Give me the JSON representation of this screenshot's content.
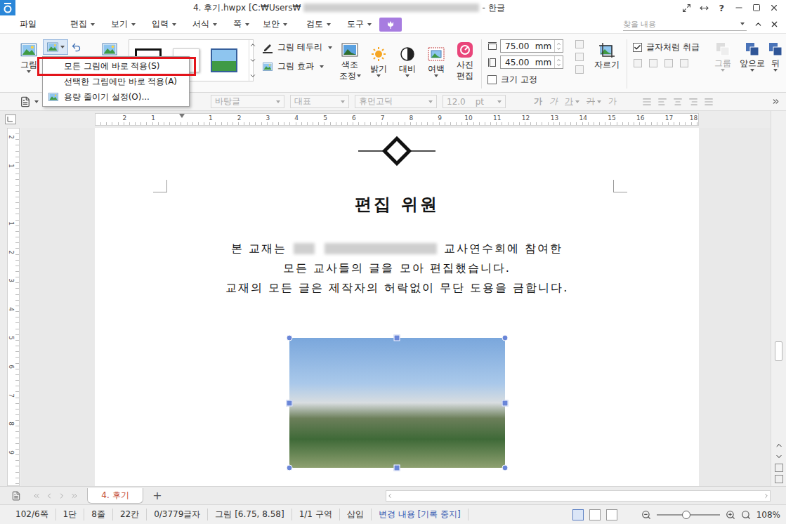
{
  "window": {
    "title_start": "4. 후기.hwpx [C:₩Users₩",
    "title_end": "- 한글",
    "help": "?"
  },
  "menu": [
    {
      "label": "파일",
      "has_caret": false
    },
    {
      "label": "편집",
      "has_caret": true
    },
    {
      "label": "보기",
      "has_caret": true
    },
    {
      "label": "입력",
      "has_caret": true
    },
    {
      "label": "서식",
      "has_caret": true
    },
    {
      "label": "쪽",
      "has_caret": true
    },
    {
      "label": "보안",
      "has_caret": true
    },
    {
      "label": "검토",
      "has_caret": true
    },
    {
      "label": "도구",
      "has_caret": true
    }
  ],
  "search": {
    "placeholder": "찾을 내용"
  },
  "ribbon": {
    "picture": {
      "label": "그림"
    },
    "apply_menu": [
      {
        "label": "모든 그림에 바로 적용(S)",
        "highlighted": true,
        "has_icon": false
      },
      {
        "label": "선택한 그림에만 바로 적용(A)",
        "highlighted": false,
        "has_icon": false
      },
      {
        "label": "용량 줄이기 설정(O)...",
        "highlighted": false,
        "has_icon": true
      }
    ],
    "frame_tools": [
      {
        "label": "그림 테두리",
        "kind": "border"
      },
      {
        "label": "그림 효과",
        "kind": "effect"
      }
    ],
    "adjust": [
      {
        "lines": [
          "색조",
          "조정"
        ],
        "kind": "tone",
        "has_caret": true
      },
      {
        "lines": [
          "밝기"
        ],
        "kind": "brightness",
        "has_caret": true
      },
      {
        "lines": [
          "대비"
        ],
        "kind": "contrast",
        "has_caret": true
      },
      {
        "lines": [
          "여백"
        ],
        "kind": "margin",
        "has_caret": true
      },
      {
        "lines": [
          "사진",
          "편집"
        ],
        "kind": "photo",
        "has_caret": false
      }
    ],
    "size": {
      "width": "75.00",
      "height": "45.00",
      "unit": "mm"
    },
    "size_lock": {
      "label": "크기 고정",
      "checked": false
    },
    "crop": {
      "label": "자르기"
    },
    "treat_as_char": {
      "label": "글자처럼 취급",
      "checked": true
    },
    "arrange": [
      {
        "label": "그룹",
        "disabled": true
      },
      {
        "label": "앞으로",
        "disabled": false
      },
      {
        "label": "뒤",
        "disabled": false
      }
    ]
  },
  "format_bar": {
    "style": "바탕글",
    "language": "대표",
    "font": "휴먼고딕",
    "size": "12.0",
    "unit": "pt",
    "disabled": true,
    "char_buttons": [
      {
        "label": "가",
        "kind": "bold"
      },
      {
        "label": "가",
        "kind": "italic"
      },
      {
        "label": "가",
        "kind": "underline"
      },
      {
        "label": "가",
        "kind": "strike"
      },
      {
        "label": "가",
        "kind": "color"
      }
    ]
  },
  "ruler": {
    "left": [
      "2",
      "1"
    ],
    "right": [
      "1",
      "2",
      "3",
      "4",
      "5",
      "6",
      "7",
      "8",
      "9",
      "10",
      "11",
      "12",
      "13",
      "14",
      "15",
      "16",
      "17",
      "18"
    ],
    "vertical_top": [
      "2",
      "1"
    ],
    "vertical_bottom": [
      "1",
      "2",
      "3",
      "4",
      "5",
      "6",
      "7",
      "8",
      "9"
    ]
  },
  "document": {
    "heading": "편집 위원",
    "lines": [
      [
        {
          "kind": "text",
          "text": "본 교재는"
        },
        {
          "kind": "blur-short"
        },
        {
          "kind": "blur-long"
        },
        {
          "kind": "text",
          "text": "교사연수회에 참여한"
        }
      ],
      [
        {
          "kind": "text",
          "text": "모든 교사들의 글을 모아 편집했습니다."
        }
      ],
      [
        {
          "kind": "text",
          "text": "교재의 모든 글은 제작자의 허락없이 무단 도용을 금합니다."
        }
      ]
    ],
    "image": {
      "selected": true
    }
  },
  "scroll": {
    "level": 0.75
  },
  "tabs": [
    {
      "label": "4. 후기",
      "selected": true
    }
  ],
  "add_tab": "+",
  "status_bar": [
    {
      "text": "102/6쪽",
      "accent": false
    },
    {
      "text": "1단",
      "accent": false
    },
    {
      "text": "8줄",
      "accent": false
    },
    {
      "text": "22칸",
      "accent": false
    },
    {
      "text": "0/3779글자",
      "accent": false
    },
    {
      "text": "그림 [6.75, 8.58]",
      "accent": false
    },
    {
      "text": "1/1 구역",
      "accent": false
    },
    {
      "text": "삽입",
      "accent": false
    },
    {
      "text": "변경 내용 [기록 중지]",
      "accent": true
    }
  ],
  "zoom": {
    "level": 0.47,
    "reading": "108%"
  }
}
